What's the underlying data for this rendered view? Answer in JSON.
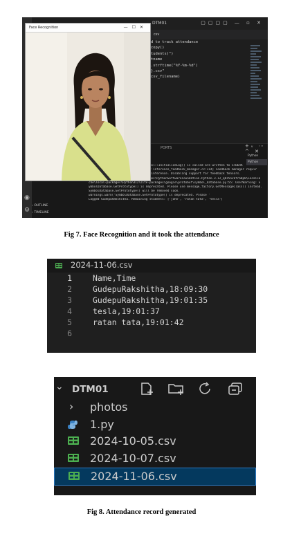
{
  "fig7": {
    "caption": "Fig 7. Face Recognition and it took the attendance",
    "camera_window": {
      "title": "Face Recognition",
      "controls": [
        "—",
        "☐",
        "✕"
      ]
    },
    "vscode": {
      "title": "DTM01",
      "tab": "csv",
      "code_lines": [
        "",
        "",
        "d to track attendance",
        "copy()",
        "tudents)\")",
        "",
        "",
        "tname",
        ".strftime(\"%Y-%m-%d\")",
        "}.csv\"",
        "",
        "",
        "",
        "csv_filename)"
      ],
      "terminal_tabs": "PORTS",
      "terminal_lines": [
        "",
        "-198",
        "",
        "'GudepuRakshitha', 'tesla']",
        "",
        "",
        "egate for CPU.",
        "WARNING: All log messages before absl::InitializeLog() is called are written to STDERR",
        "W0000 00:00:1730896766.988881   11452 inference_feedback_manager.cc:114] Feedback manager requir",
        "es a model with a single signature inference. Disabling support for feedback tensors.",
        "C:\\Users\\raksh\\AppData\\Local\\Packages\\PythonSoftwareFoundation.Python.3.12_qbz5n2kfra8p0\\LocalCa",
        "che\\local-packages\\Python312\\site-packages\\google\\protobuf\\symbol_database.py:55: UserWarning: S",
        "ymbolDatabase.GetPrototype() is deprecated. Please use message_factory.GetMessageClass() instead.",
        " SymbolDatabase.GetPrototype() will be removed soon.",
        "  warnings.warn('SymbolDatabase.GetPrototype() is deprecated. Please '",
        "Logged GudepuRakshitha. Remaining students: ['john', 'ratan tata', 'tesla']"
      ],
      "terminal_list": [
        "Python",
        "Python"
      ],
      "explorer_sections": [
        "OUTLINE",
        "TIMELINE"
      ]
    }
  },
  "csv_view": {
    "filename": "2024-11-06.csv",
    "lines": [
      {
        "n": "1",
        "text": "Name,Time"
      },
      {
        "n": "2",
        "text": "GudepuRakshitha,18:09:30"
      },
      {
        "n": "3",
        "text": "GudepuRakshitha,19:01:35"
      },
      {
        "n": "4",
        "text": "tesla,19:01:37"
      },
      {
        "n": "5",
        "text": "ratan tata,19:01:42"
      },
      {
        "n": "6",
        "text": ""
      }
    ]
  },
  "explorer": {
    "project": "DTM01",
    "header_icons": [
      "new-file-icon",
      "new-folder-icon",
      "refresh-icon",
      "collapse-all-icon"
    ],
    "items": [
      {
        "label": "photos",
        "icon": "chevron-right-icon"
      },
      {
        "label": "1.py",
        "icon": "python-icon"
      },
      {
        "label": "2024-10-05.csv",
        "icon": "csv-table-icon"
      },
      {
        "label": "2024-10-07.csv",
        "icon": "csv-table-icon"
      },
      {
        "label": "2024-11-06.csv",
        "icon": "csv-table-icon",
        "selected": true
      }
    ]
  },
  "fig8": {
    "caption": "Fig 8. Attendance record generated"
  },
  "colors": {
    "editor_bg": "#1f1f1f",
    "selection_bg": "#04395e",
    "csv_icon": "#4caf50",
    "python_icon": "#3b82c4"
  }
}
